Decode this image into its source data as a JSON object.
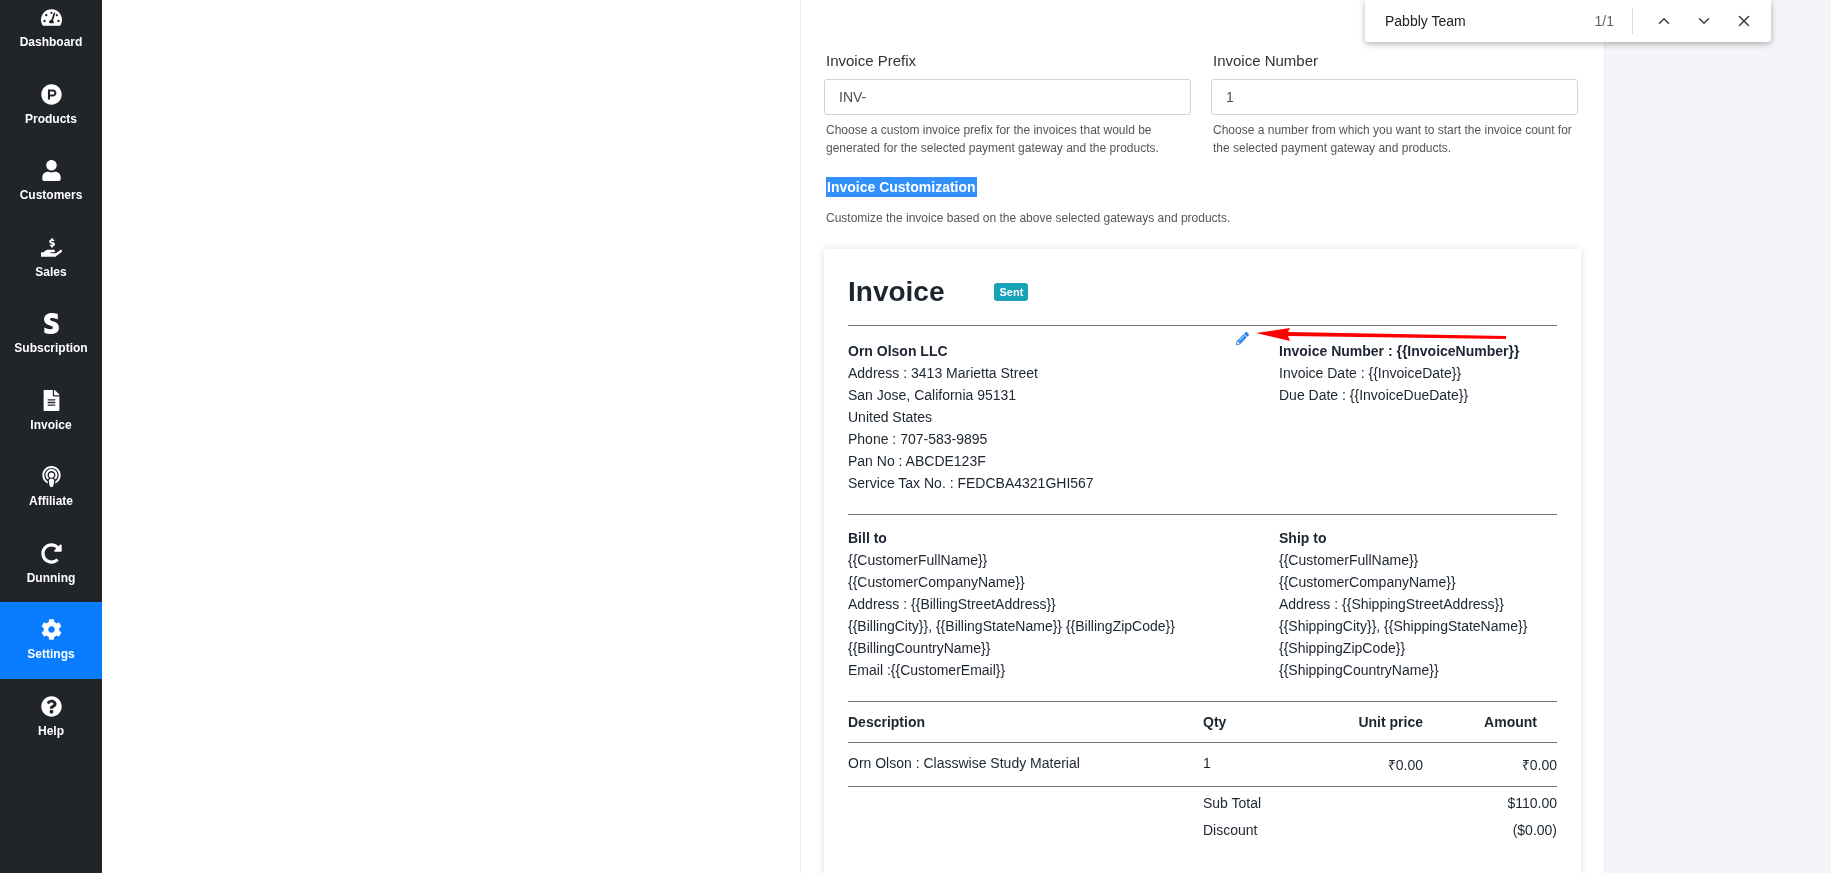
{
  "sidebar": {
    "items": [
      {
        "label": "Dashboard",
        "selected": false
      },
      {
        "label": "Products",
        "selected": false
      },
      {
        "label": "Customers",
        "selected": false
      },
      {
        "label": "Sales",
        "selected": false
      },
      {
        "label": "Subscription",
        "selected": false
      },
      {
        "label": "Invoice",
        "selected": false
      },
      {
        "label": "Affiliate",
        "selected": false
      },
      {
        "label": "Dunning",
        "selected": false
      },
      {
        "label": "Settings",
        "selected": true
      },
      {
        "label": "Help",
        "selected": false
      }
    ]
  },
  "find_bar": {
    "query": "Pabbly Team",
    "count": "1/1"
  },
  "form": {
    "fields": [
      {
        "label": "Invoice Prefix",
        "value": "INV-",
        "help": "Choose a custom invoice prefix for the invoices that would be generated for the selected payment gateway and the products."
      },
      {
        "label": "Invoice Number",
        "value": "1",
        "help": "Choose a number from which you want to start the invoice count for the selected payment gateway and products."
      }
    ],
    "section_title": "Invoice Customization",
    "section_description": "Customize the invoice based on the above selected gateways and products."
  },
  "invoice": {
    "title": "Invoice",
    "status": "Sent",
    "company": {
      "name": "Orn Olson LLC",
      "lines": [
        "Address : 3413 Marietta Street",
        "San Jose, California 95131",
        "United States",
        "Phone : 707-583-9895",
        "Pan No : ABCDE123F",
        "Service Tax No. : FEDCBA4321GHI567"
      ]
    },
    "meta": [
      "Invoice Number : {{InvoiceNumber}}",
      "Invoice Date : {{InvoiceDate}}",
      "Due Date : {{InvoiceDueDate}}"
    ],
    "bill_to": {
      "title": "Bill to",
      "lines": [
        "{{CustomerFullName}}",
        "{{CustomerCompanyName}}",
        "Address : {{BillingStreetAddress}}",
        "{{BillingCity}}, {{BillingStateName}} {{BillingZipCode}}",
        "{{BillingCountryName}}",
        "Email :{{CustomerEmail}}"
      ]
    },
    "ship_to": {
      "title": "Ship to",
      "lines": [
        "{{CustomerFullName}}",
        "{{CustomerCompanyName}}",
        "Address : {{ShippingStreetAddress}}",
        "{{ShippingCity}}, {{ShippingStateName}}",
        "{{ShippingZipCode}}",
        "{{ShippingCountryName}}"
      ]
    },
    "table": {
      "columns": [
        "Description",
        "Qty",
        "Unit price",
        "Amount"
      ],
      "rows": [
        [
          "Orn Olson : Classwise Study Material",
          "1",
          "₹0.00",
          "₹0.00"
        ]
      ]
    },
    "totals": [
      {
        "label": "Sub Total",
        "value": "$110.00"
      },
      {
        "label": "Discount",
        "value": "($0.00)"
      }
    ]
  }
}
